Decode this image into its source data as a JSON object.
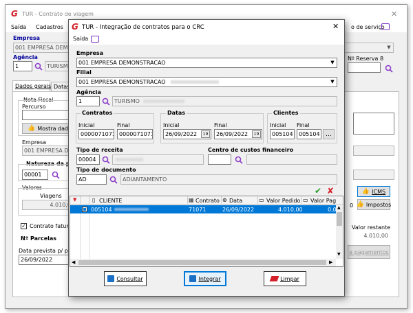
{
  "bg": {
    "title": "TUR - Contrato de viagem",
    "menu": [
      "Saída",
      "Cadastros"
    ],
    "menu_right": "o de serviço",
    "empresa_label": "Empresa",
    "empresa_value": "001 EMPRESA DEMO",
    "agencia_label": "Agência",
    "agencia_code": "1",
    "agencia_name": "TURISMO",
    "reserva_label": "Nº Reserva 8",
    "tabs": [
      "Dados gerais",
      "Datas"
    ],
    "nota_fiscal": "Nota Fiscal",
    "percurso": "Percurso",
    "mostra_dados": "Mostra dado",
    "empresa2_label": "Empresa",
    "empresa2_value": "001 EMPRESA DE",
    "natureza_label": "Natureza da pr",
    "natureza_code": "00001",
    "valores_label": "Valores",
    "viagens_label": "Viagens",
    "viagens_value": "4.010,00",
    "icms_btn": "ICMS",
    "impostos_btn": "Impostos",
    "contrato_faturado": "Contrato faturad",
    "parcelas_label": "Nº Parcelas",
    "data_prevista_label": "Data prevista p/ pagt",
    "data_prevista_value": "26/09/2022",
    "valor_restante_label": "Valor restante",
    "valor_restante_value": "4.010,00",
    "pagamentos_btn": "a pagamentos",
    "dd_value": "0"
  },
  "dialog": {
    "title": "TUR - Integração de contratos para o CRC",
    "menu": "Saída",
    "empresa_label": "Empresa",
    "empresa_value": "001 EMPRESA DEMONSTRACAO",
    "filial_label": "Filial",
    "filial_value": "001 EMPRESA DEMONSTRACAO",
    "agencia_label": "Agência",
    "agencia_code": "1",
    "agencia_name": "TURISMO",
    "contratos_label": "Contratos",
    "datas_label": "Datas",
    "clientes_label": "Clientes",
    "inicial": "Inicial",
    "final": "Final",
    "contrato_inicial": "0000071071",
    "contrato_final": "0000071071",
    "data_inicial": "26/09/2022",
    "data_final": "26/09/2022",
    "cliente_inicial": "005104",
    "cliente_final": "005104",
    "tipo_receita_label": "Tipo de receita",
    "tipo_receita_code": "00004",
    "centro_custos_label": "Centro de custos financeiro",
    "tipo_documento_label": "Tipo de documento",
    "tipo_documento_code": "AD",
    "tipo_documento_name": "ADIANTAMENTO",
    "grid_headers": [
      "CLIENTE",
      "Contrato",
      "Data",
      "Valor Pedido",
      "Valor Pag"
    ],
    "grid_row": {
      "cliente": "005104",
      "contrato": "71071",
      "data": "26/09/2022",
      "valor_pedido": "4.010,00",
      "valor_pag": "0,0"
    },
    "btn_consultar": "Consultar",
    "btn_integrar": "Integrar",
    "btn_limpar": "Limpar"
  },
  "colors": {
    "accent": "#0078d7",
    "select": "#0078d7",
    "logo": "#d4202a"
  }
}
